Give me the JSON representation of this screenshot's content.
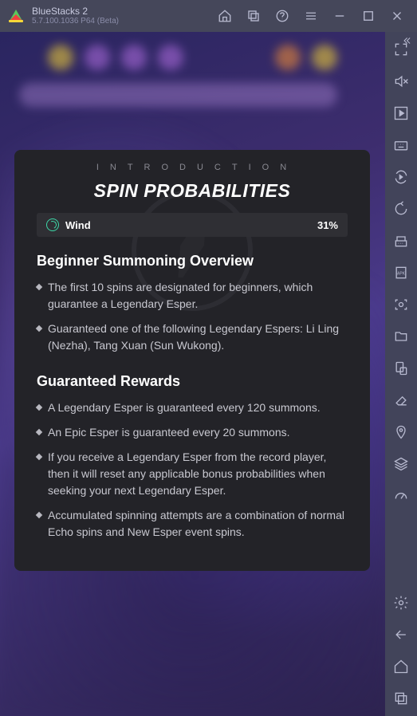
{
  "titlebar": {
    "app_name": "BlueStacks 2",
    "version": "5.7.100.1036   P64 (Beta)"
  },
  "modal": {
    "intro_label": "INTRODUCTION",
    "title": "SPIN PROBABILITIES",
    "prob_row": {
      "label": "Wind",
      "value": "31%"
    },
    "section1_title": "Beginner Summoning Overview",
    "section1_items": [
      "The first 10 spins are designated for beginners, which guarantee a Legendary Esper.",
      "Guaranteed one of the following Legendary Espers: Li Ling (Nezha), Tang Xuan (Sun Wukong)."
    ],
    "section2_title": "Guaranteed Rewards",
    "section2_items": [
      "A Legendary Esper is guaranteed every 120 summons.",
      "An Epic Esper is guaranteed every 20 summons.",
      "If you receive a Legendary Esper from the record player, then it will reset any applicable bonus probabilities when seeking your next Legendary Esper.",
      "Accumulated spinning attempts are a combination of normal Echo spins and New Esper event spins."
    ]
  }
}
